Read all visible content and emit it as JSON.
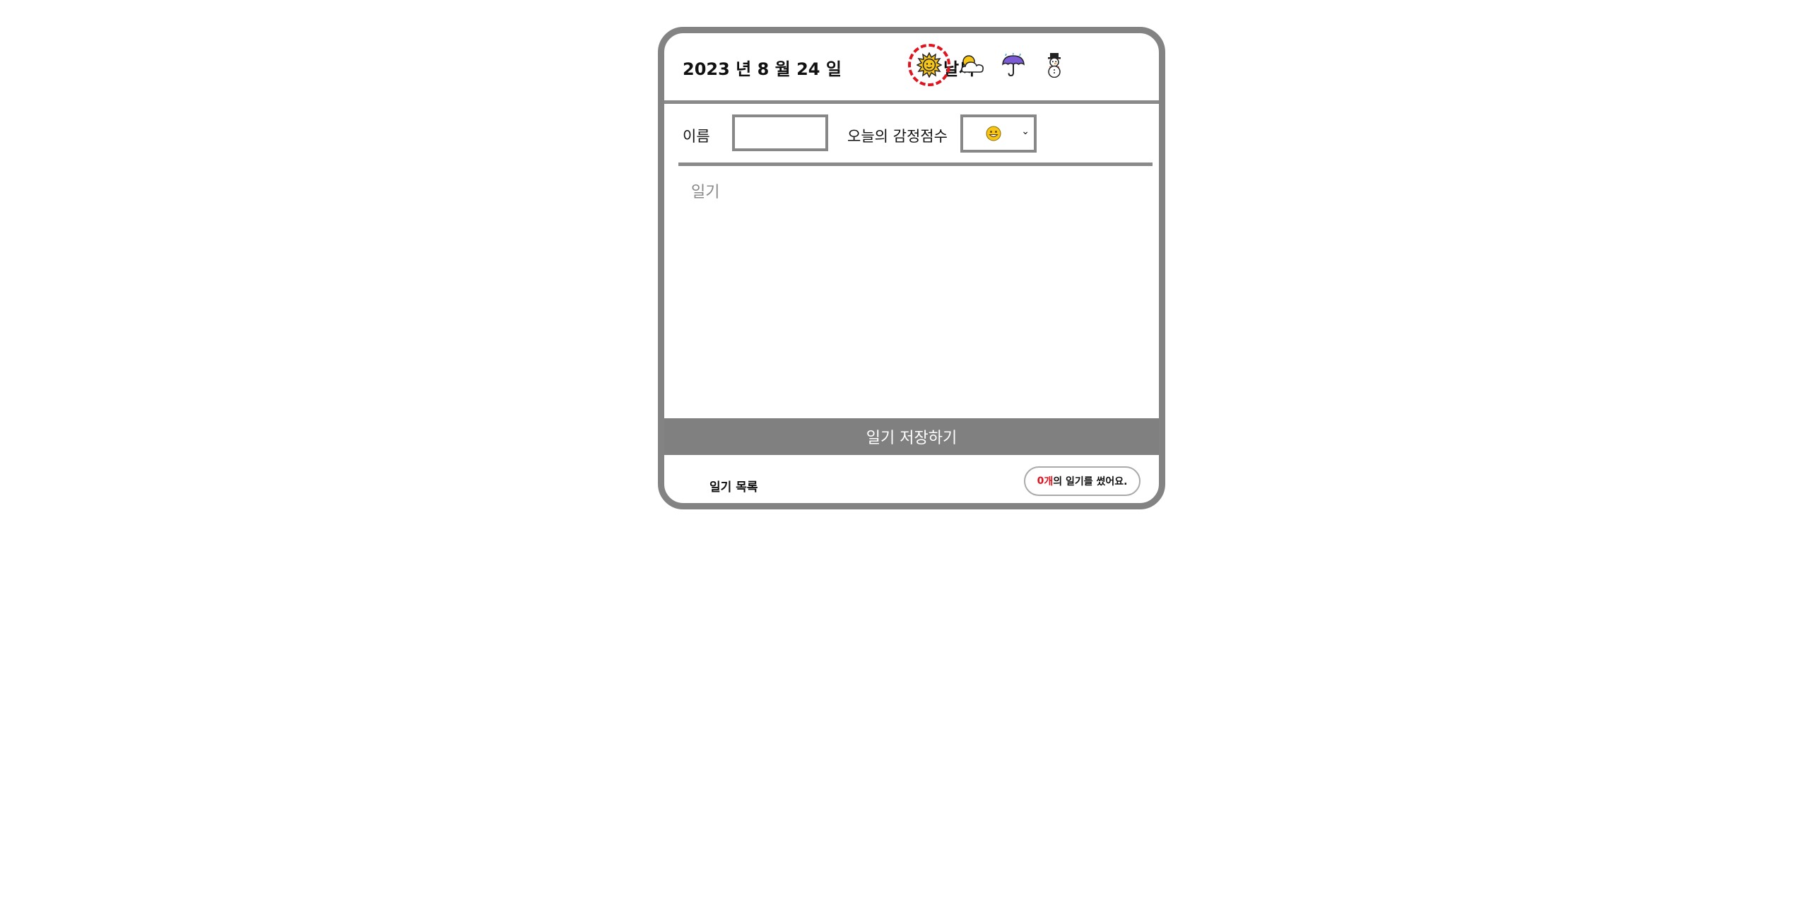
{
  "header": {
    "date": "2023 년 8 월 24 일",
    "weather_label": "날씨",
    "weather_options": [
      {
        "icon": "sun-icon",
        "selected": true
      },
      {
        "icon": "sun-behind-cloud-icon",
        "selected": false
      },
      {
        "icon": "umbrella-rain-icon",
        "selected": false
      },
      {
        "icon": "snowman-icon",
        "selected": false
      }
    ]
  },
  "form": {
    "name_label": "이름",
    "name_value": "",
    "score_label": "오늘의 감정점수",
    "score_selected_icon": "grinning-face-icon",
    "diary_placeholder": "일기"
  },
  "actions": {
    "save_label": "일기 저장하기"
  },
  "list": {
    "title": "일기 목록",
    "count": "0",
    "count_unit": "개",
    "count_suffix": "의 일기를 썼어요."
  },
  "colors": {
    "border": "#838383",
    "accent_red": "#e0141e",
    "button_bg": "#808080"
  }
}
